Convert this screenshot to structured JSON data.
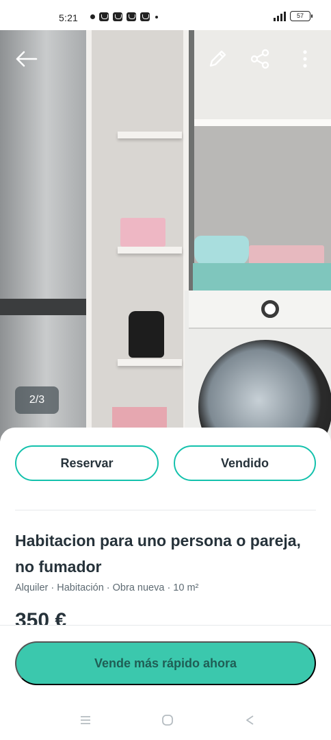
{
  "status_bar": {
    "time": "5:21",
    "battery": "57"
  },
  "photo": {
    "counter": "2/3"
  },
  "actions": {
    "reserve_label": "Reservar",
    "sold_label": "Vendido"
  },
  "listing": {
    "title": "Habitacion para uno persona o pareja, no fumador",
    "details": "Alquiler · Habitación · Obra nueva · 10 m²",
    "price": "350 €"
  },
  "cta": {
    "label": "Vende más rápido ahora"
  },
  "colors": {
    "accent": "#13c1ac",
    "cta_background": "#3bc8ad",
    "text": "#26323a"
  },
  "icons": {
    "back": "arrow-left-icon",
    "edit": "pencil-icon",
    "share": "share-icon",
    "more": "more-vertical-icon"
  }
}
